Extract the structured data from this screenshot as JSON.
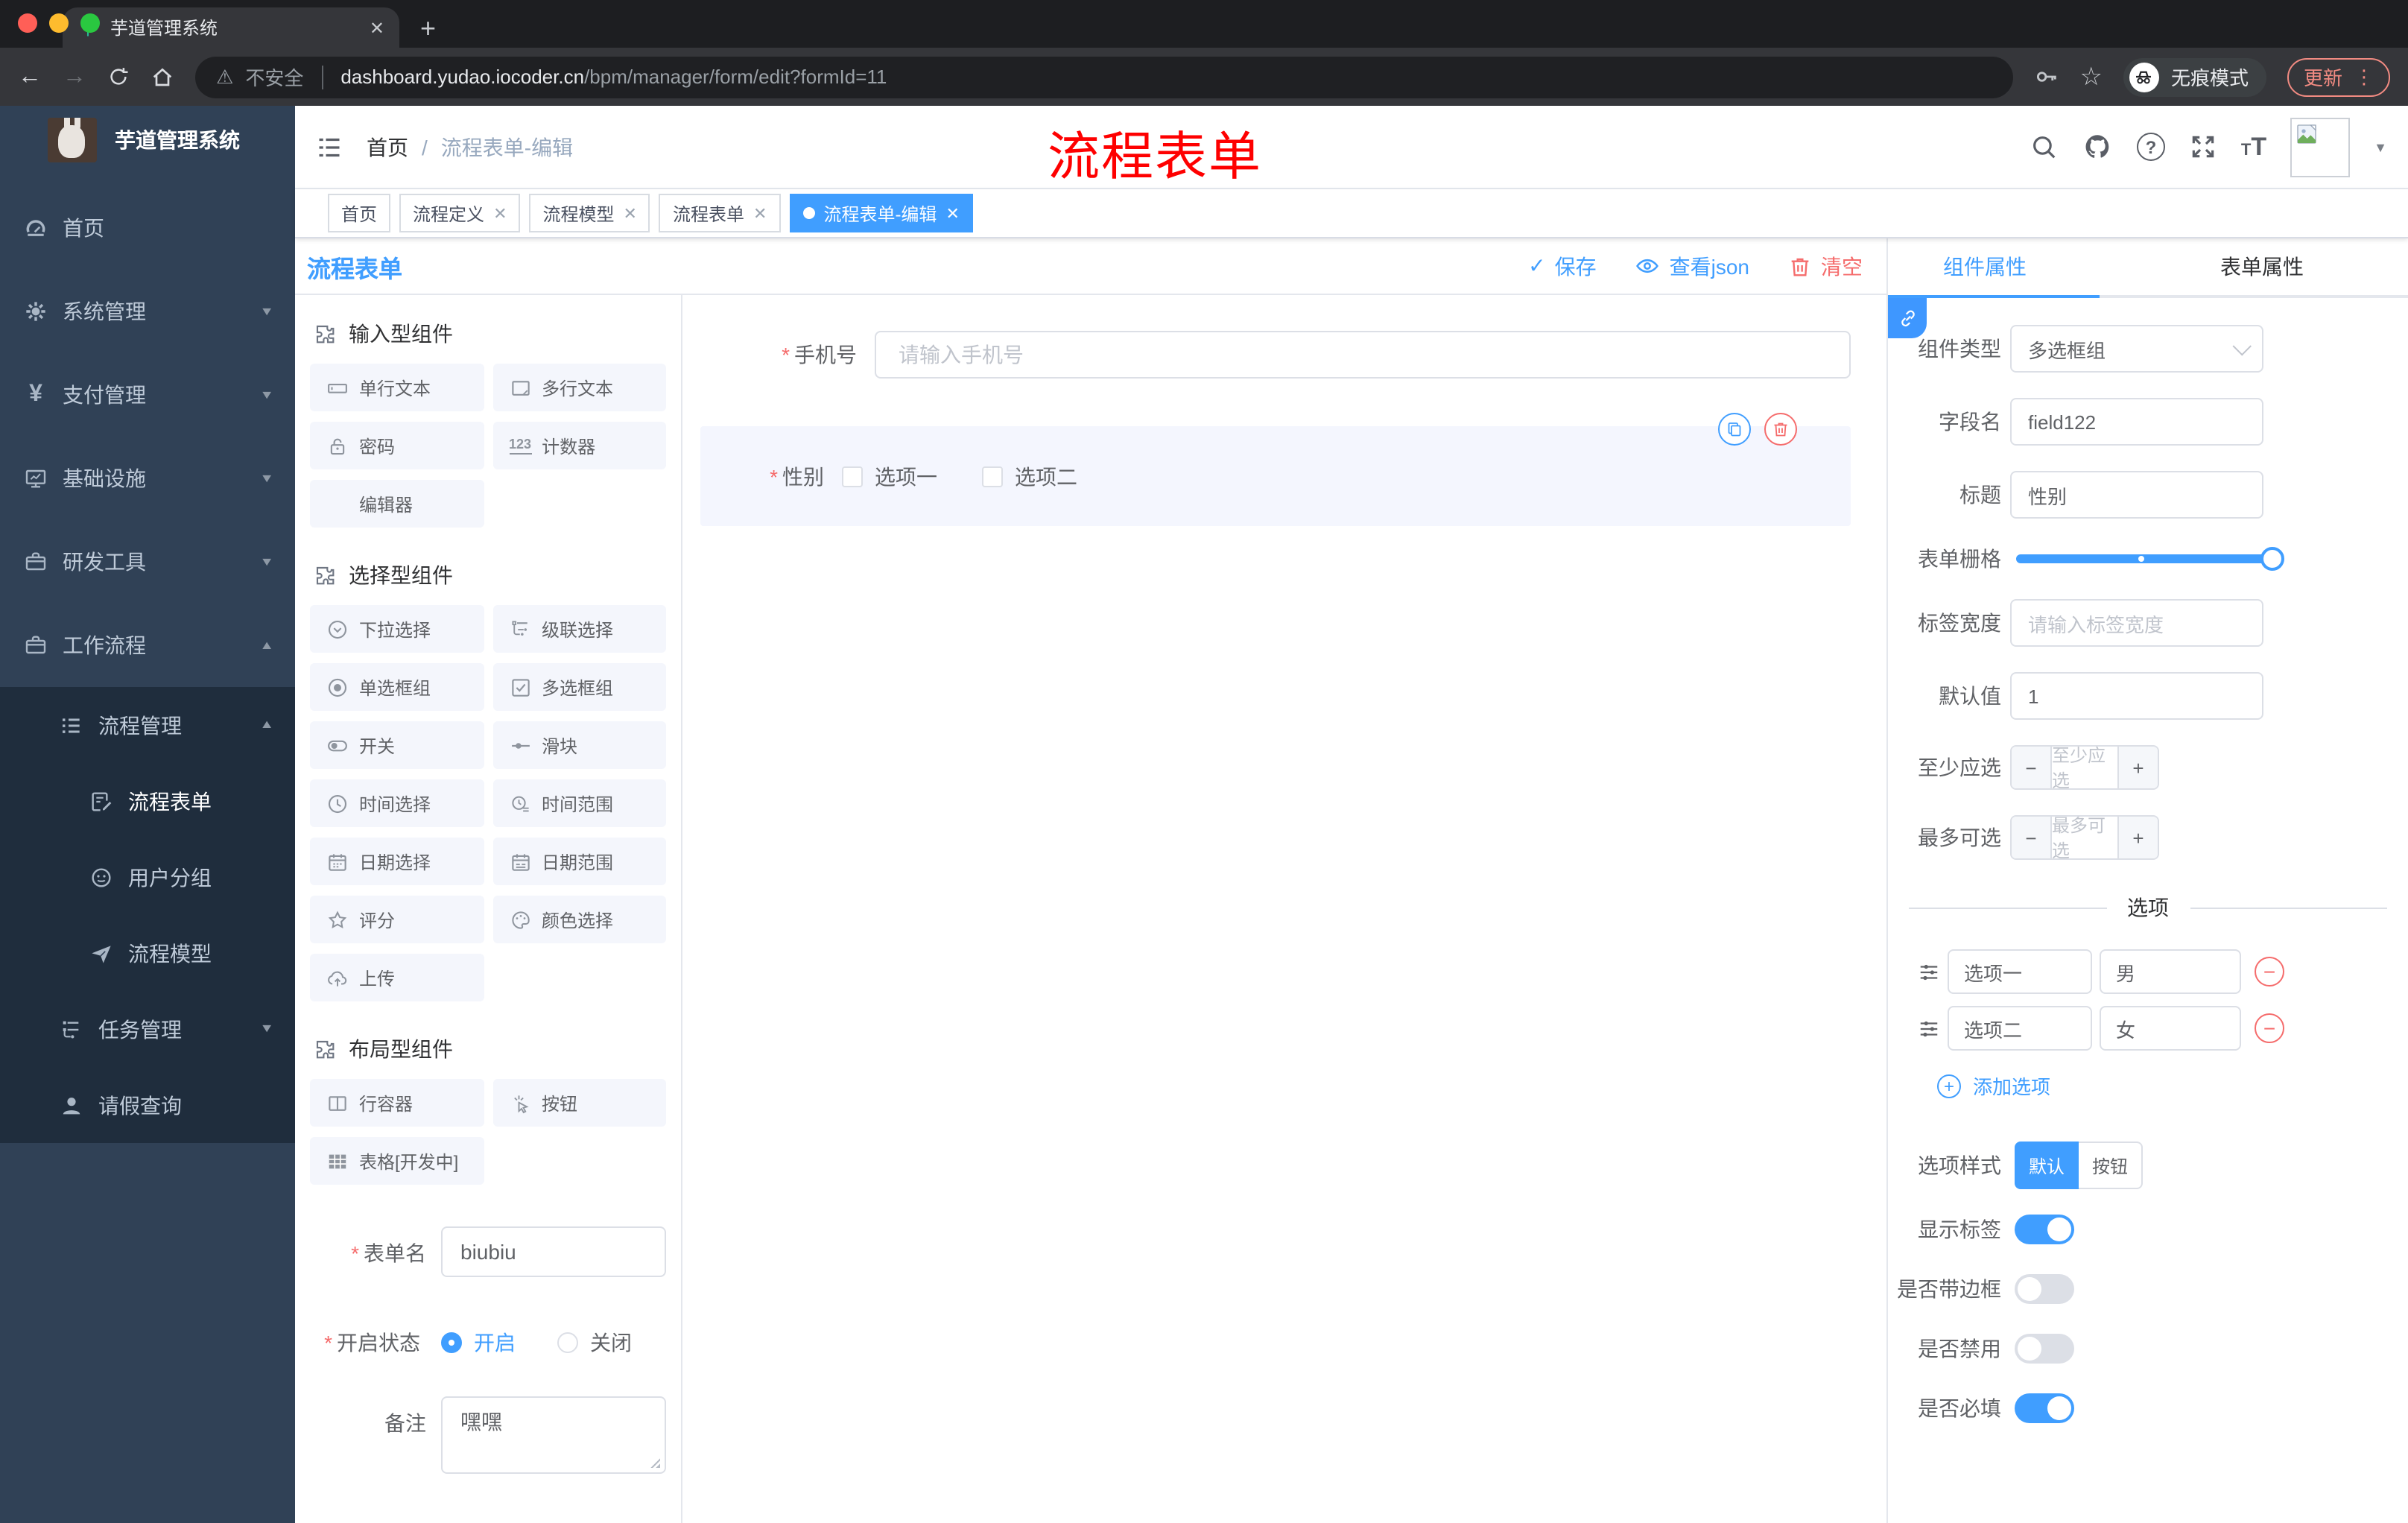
{
  "colors": {
    "accent": "#409eff",
    "danger": "#f56c6c",
    "sidebar_bg": "#304156",
    "submenu_bg": "#1f2d3d",
    "annotation": "#fe0000",
    "active_tag_bg": "#409eff"
  },
  "browser": {
    "tab_title": "芋道管理系统",
    "security_label": "不安全",
    "url_domain": "dashboard.yudao.iocoder.cn",
    "url_path": "/bpm/manager/form/edit?formId=11",
    "incognito_label": "无痕模式",
    "update_label": "更新"
  },
  "header": {
    "breadcrumb_home": "首页",
    "breadcrumb_sep": "/",
    "breadcrumb_current": "流程表单-编辑",
    "annotation": "流程表单"
  },
  "tag_tabs": {
    "items": [
      {
        "label": "首页"
      },
      {
        "label": "流程定义"
      },
      {
        "label": "流程模型"
      },
      {
        "label": "流程表单"
      },
      {
        "label": "流程表单-编辑"
      }
    ]
  },
  "sidebar": {
    "title": "芋道管理系统",
    "items": [
      {
        "label": "首页"
      },
      {
        "label": "系统管理"
      },
      {
        "label": "支付管理"
      },
      {
        "label": "基础设施"
      },
      {
        "label": "研发工具"
      },
      {
        "label": "工作流程"
      },
      {
        "label": "流程管理"
      },
      {
        "label": "流程表单"
      },
      {
        "label": "用户分组"
      },
      {
        "label": "流程模型"
      },
      {
        "label": "任务管理"
      },
      {
        "label": "请假查询"
      }
    ]
  },
  "designer": {
    "title": "流程表单",
    "save_label": "保存",
    "view_json_label": "查看json",
    "clear_label": "清空"
  },
  "components": {
    "sections": [
      {
        "title": "输入型组件",
        "items": [
          "单行文本",
          "多行文本",
          "密码",
          "计数器",
          "编辑器"
        ]
      },
      {
        "title": "选择型组件",
        "items": [
          "下拉选择",
          "级联选择",
          "单选框组",
          "多选框组",
          "开关",
          "滑块",
          "时间选择",
          "时间范围",
          "日期选择",
          "日期范围",
          "评分",
          "颜色选择",
          "上传"
        ]
      },
      {
        "title": "布局型组件",
        "items": [
          "行容器",
          "按钮",
          "表格[开发中]"
        ]
      }
    ]
  },
  "meta_form": {
    "form_name_label": "表单名",
    "form_name_value": "biubiu",
    "status_label": "开启状态",
    "status_on": "开启",
    "status_off": "关闭",
    "remark_label": "备注",
    "remark_value": "嘿嘿"
  },
  "canvas": {
    "phone_label": "手机号",
    "phone_placeholder": "请输入手机号",
    "gender_label": "性别",
    "gender_options": [
      "选项一",
      "选项二"
    ]
  },
  "props": {
    "tab_component": "组件属性",
    "tab_form": "表单属性",
    "type_label": "组件类型",
    "type_value": "多选框组",
    "field_label": "字段名",
    "field_value": "field122",
    "title_label": "标题",
    "title_value": "性别",
    "grid_label": "表单栅格",
    "label_width_label": "标签宽度",
    "label_width_placeholder": "请输入标签宽度",
    "default_label": "默认值",
    "default_value": "1",
    "min_label": "至少应选",
    "min_placeholder": "至少应选",
    "max_label": "最多可选",
    "max_placeholder": "最多可选",
    "options_divider": "选项",
    "options": [
      {
        "label": "选项一",
        "value": "男"
      },
      {
        "label": "选项二",
        "value": "女"
      }
    ],
    "add_option": "添加选项",
    "style_label": "选项样式",
    "style_default": "默认",
    "style_button": "按钮",
    "toggles": [
      {
        "label": "显示标签",
        "on": true
      },
      {
        "label": "是否带边框",
        "on": false
      },
      {
        "label": "是否禁用",
        "on": false
      },
      {
        "label": "是否必填",
        "on": true
      }
    ]
  }
}
